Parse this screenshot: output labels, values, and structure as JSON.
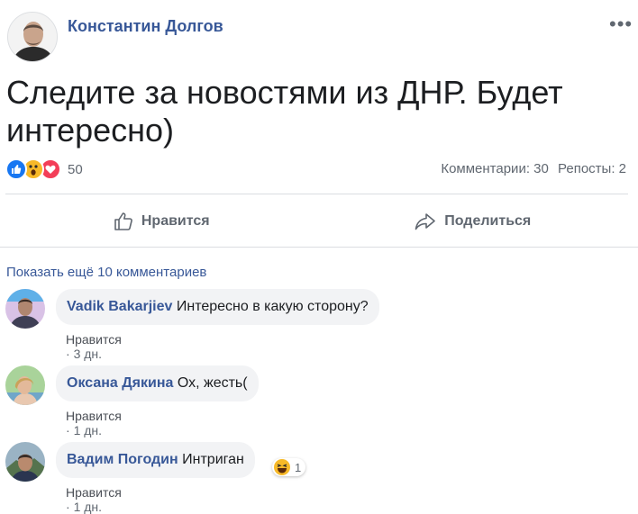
{
  "post": {
    "author": "Константин Долгов",
    "menu_icon": "more-icon",
    "text": "Следите за новостями из ДНР. Будет интересно)",
    "reactions": {
      "icons": [
        "like-reaction-icon",
        "wow-reaction-icon",
        "love-reaction-icon"
      ],
      "count": "50"
    },
    "comments_count": "Комментарии: 30",
    "shares_count": "Репосты: 2",
    "actions": {
      "like": "Нравится",
      "share": "Поделиться"
    }
  },
  "comments_section": {
    "more_link": "Показать ещё 10 комментариев",
    "items": [
      {
        "name": "Vadik Bakarjiev",
        "text": "Интересно в какую сторону?",
        "like": "Нравится",
        "sep": " · ",
        "time": "3 дн."
      },
      {
        "name": "Оксана Дякина",
        "text": "Ох, жесть(",
        "like": "Нравится",
        "sep": " · ",
        "time": "1 дн."
      },
      {
        "name": "Вадим Погодин",
        "text": "Интриган",
        "like": "Нравится",
        "sep": " · ",
        "time": "1 дн.",
        "reaction": "haha-reaction-icon",
        "reaction_count": "1"
      }
    ]
  },
  "colors": {
    "link": "#385898",
    "secondary_text": "#606770",
    "bubble": "#f2f3f5",
    "like_blue": "#1877f2",
    "love_red": "#f33e58",
    "wow_yellow": "#f7b928"
  }
}
